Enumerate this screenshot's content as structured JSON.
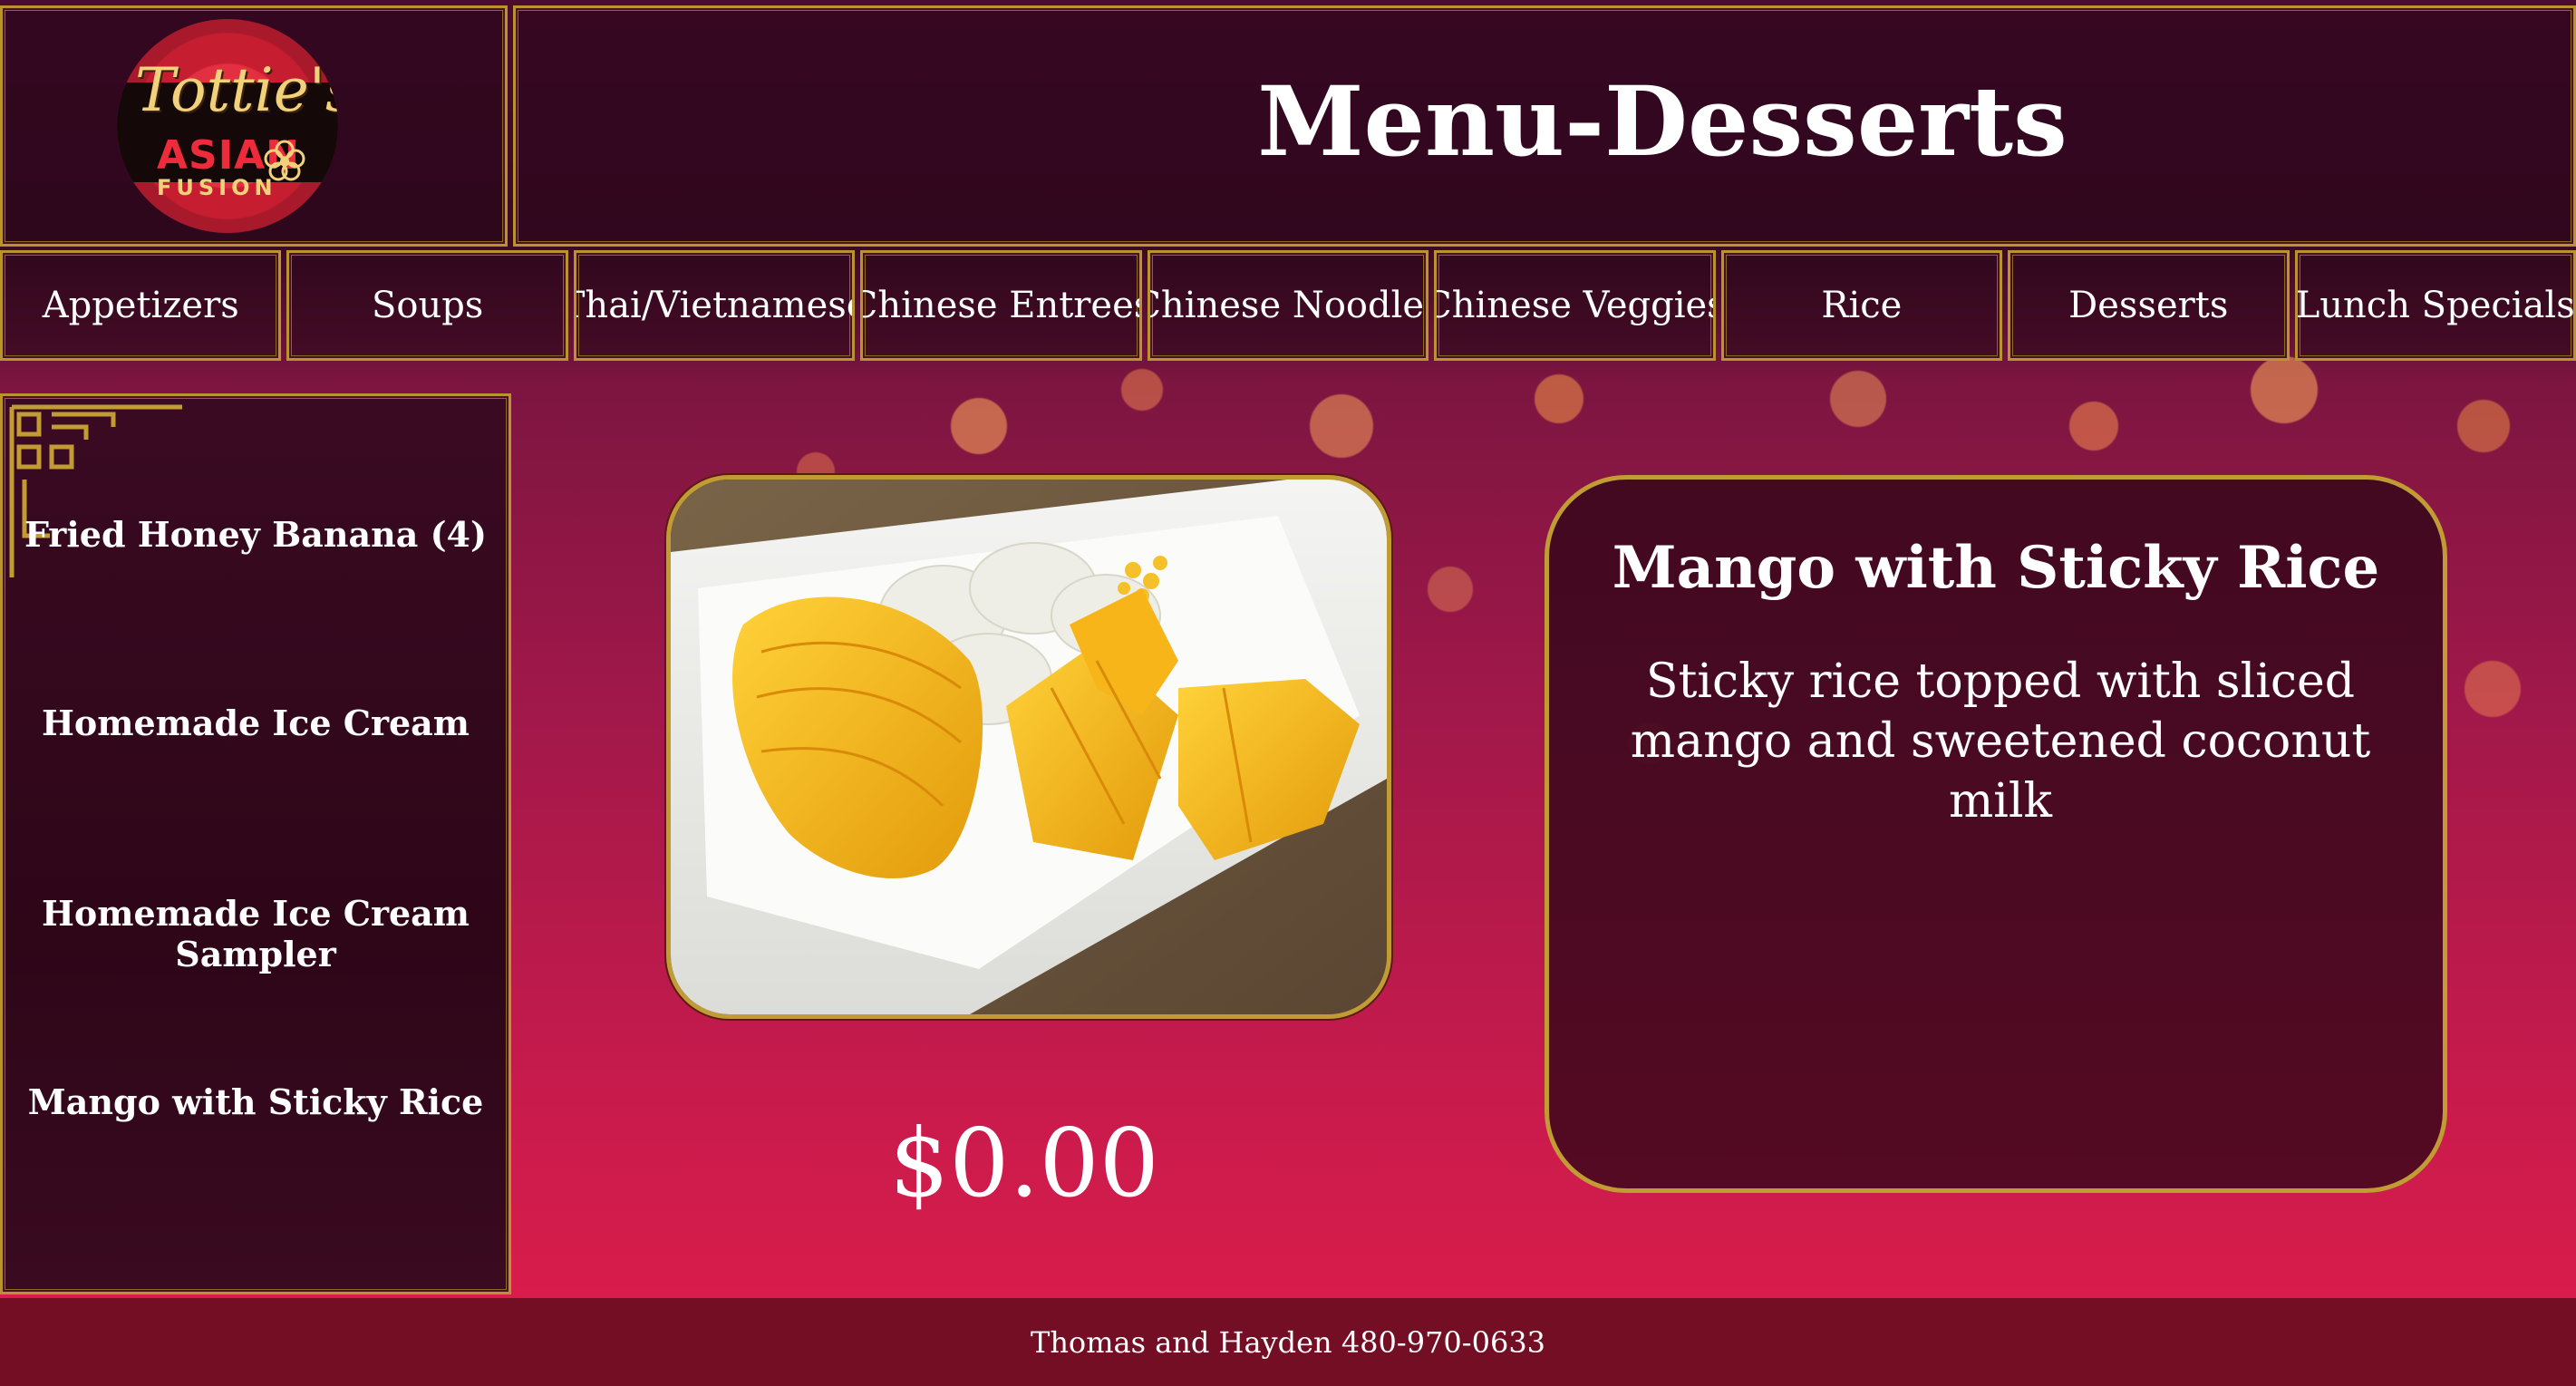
{
  "header": {
    "logo": {
      "script": "Tottie's",
      "line2": "ASIAN",
      "line3": "FUSION"
    },
    "title": "Menu-Desserts"
  },
  "nav": {
    "items": [
      {
        "label": "Appetizers"
      },
      {
        "label": "Soups"
      },
      {
        "label": "Thai/Vietnamese"
      },
      {
        "label": "Chinese Entrees"
      },
      {
        "label": "Chinese Noodles"
      },
      {
        "label": "Chinese Veggies"
      },
      {
        "label": "Rice"
      },
      {
        "label": "Desserts"
      },
      {
        "label": "Lunch Specials"
      }
    ]
  },
  "sidebar": {
    "items": [
      {
        "label": "Fried Honey Banana (4)"
      },
      {
        "label": "Homemade Ice Cream"
      },
      {
        "label": "Homemade Ice Cream Sampler"
      },
      {
        "label": "Mango with Sticky Rice"
      }
    ]
  },
  "dish": {
    "image_icon": "mango-sticky-rice-photo",
    "price": "$0.00",
    "title": "Mango with Sticky Rice",
    "description": "Sticky rice topped with sliced mango and sweetened coconut milk"
  },
  "footer": {
    "text": "Thomas and Hayden 480-970-0633"
  },
  "colors": {
    "gold": "#b8932e",
    "panel": "#3a0a22",
    "footer": "#730e24",
    "background_bottom": "#d81c4b"
  }
}
